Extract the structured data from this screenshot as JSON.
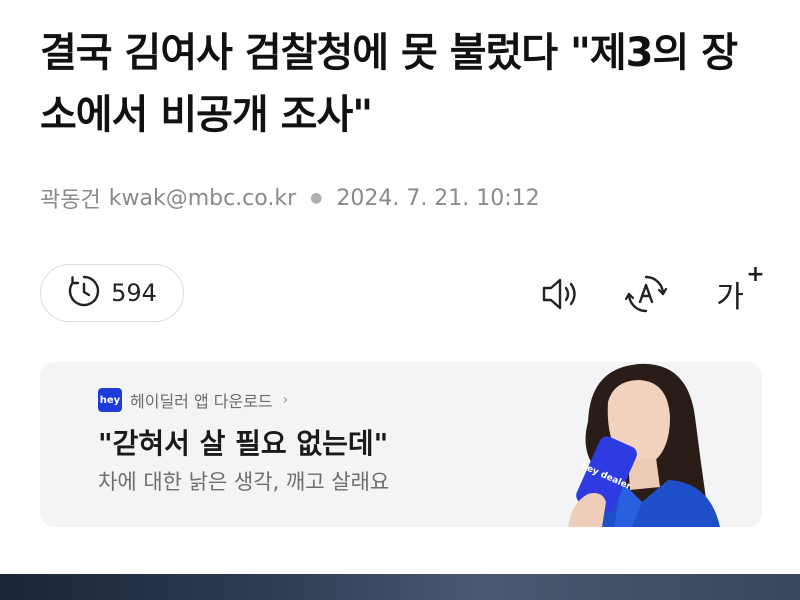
{
  "article": {
    "headline": "결국 김여사 검찰청에 못 불렀다 \"제3의 장소에서 비공개 조사\"",
    "author": "곽동건",
    "email": "kwak@mbc.co.kr",
    "datetime": "2024. 7. 21. 10:12"
  },
  "toolbar": {
    "views_count": "594",
    "font_size_label": "가",
    "font_size_plus": "+",
    "icons": [
      "clock-icon",
      "speaker-icon",
      "translate-icon",
      "font-size-icon"
    ]
  },
  "ad": {
    "brand_logo_text": "hey",
    "source_label": "헤이딜러 앱 다운로드",
    "source_chevron": "›",
    "headline": "\"갇혀서 살 필요 없는데\"",
    "subtext": "차에 대한 낡은 생각, 깨고 살래요",
    "phone_text": "hey dealer"
  },
  "colors": {
    "accent_blue": "#1e3ad8",
    "ad_background": "#f3f4f6",
    "meta_gray": "#8a8a8a"
  }
}
